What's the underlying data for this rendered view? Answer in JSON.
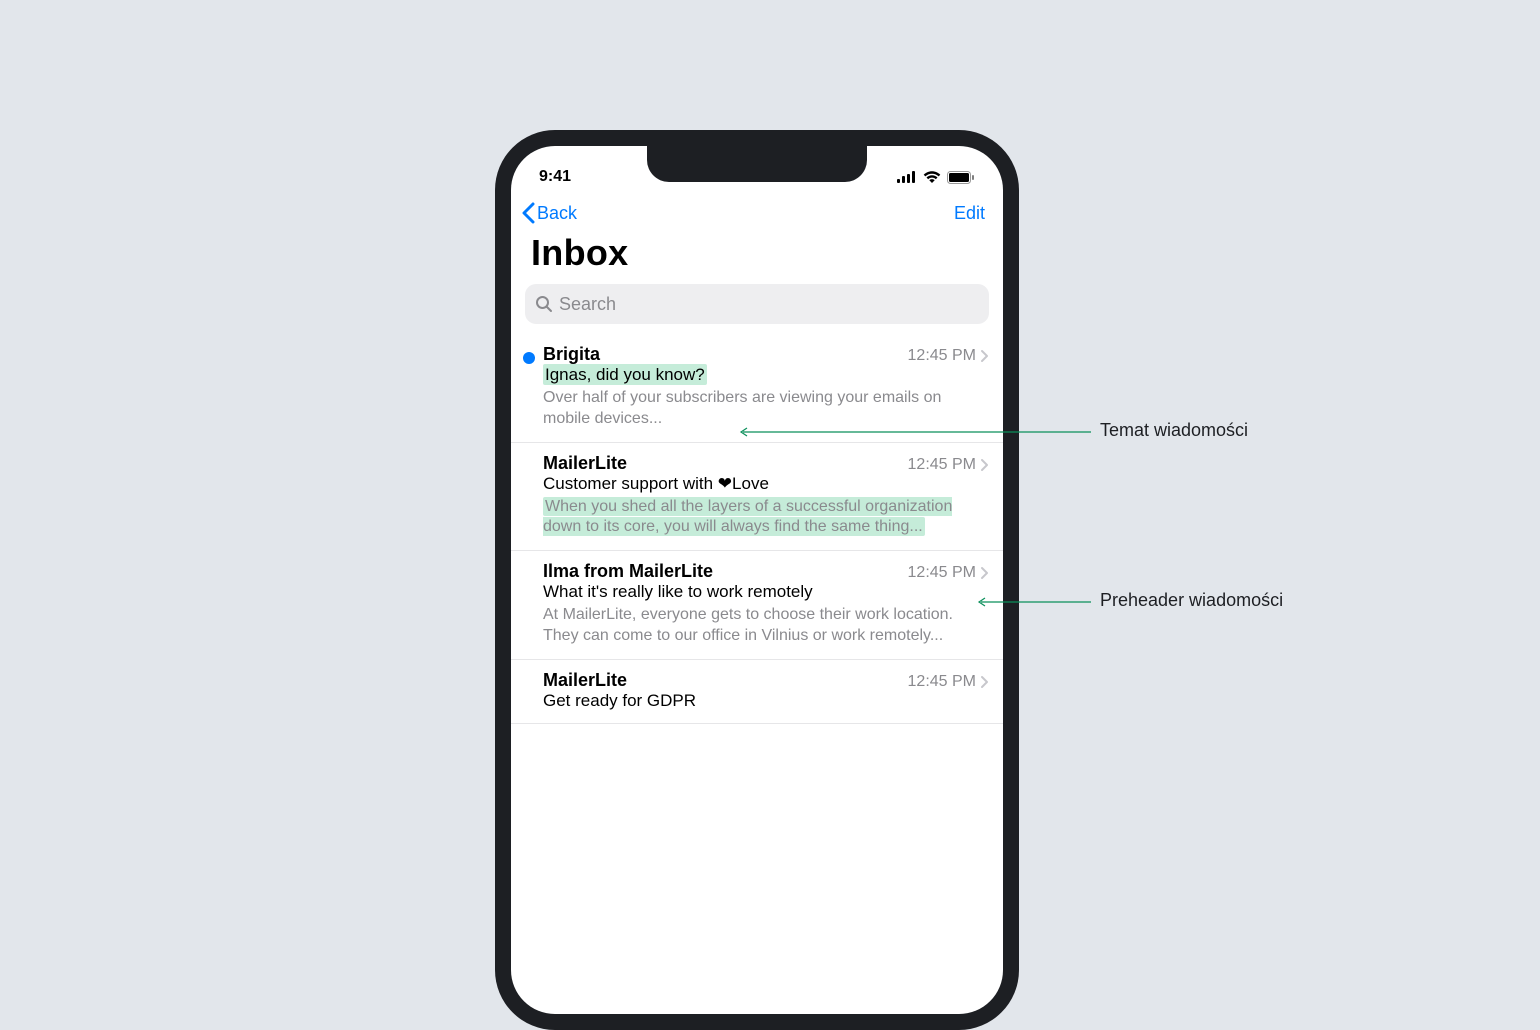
{
  "status_bar": {
    "time": "9:41"
  },
  "nav": {
    "back_label": "Back",
    "edit_label": "Edit"
  },
  "title": "Inbox",
  "search": {
    "placeholder": "Search"
  },
  "annotations": {
    "subject": "Temat wiadomości",
    "preheader": "Preheader wiadomości"
  },
  "emails": [
    {
      "unread": true,
      "sender": "Brigita",
      "time": "12:45 PM",
      "subject": "Ignas, did you know?",
      "subject_highlight": true,
      "preview": "Over half of your subscribers are viewing your emails on mobile devices...",
      "preview_highlight": false
    },
    {
      "unread": false,
      "sender": "MailerLite",
      "time": "12:45 PM",
      "subject": "Customer support with ❤Love",
      "subject_highlight": false,
      "preview": "When you shed all the layers of a successful organization down to its core, you will always find the same thing...",
      "preview_highlight": true
    },
    {
      "unread": false,
      "sender": "Ilma from MailerLite",
      "time": "12:45 PM",
      "subject": "What it's really like to work remotely",
      "subject_highlight": false,
      "preview": "At MailerLite, everyone gets to choose their work location. They can come to our office in Vilnius or work remotely...",
      "preview_highlight": false
    },
    {
      "unread": false,
      "sender": "MailerLite",
      "time": "12:45 PM",
      "subject": "Get ready for GDPR",
      "subject_highlight": false,
      "preview": "",
      "preview_highlight": false
    }
  ]
}
